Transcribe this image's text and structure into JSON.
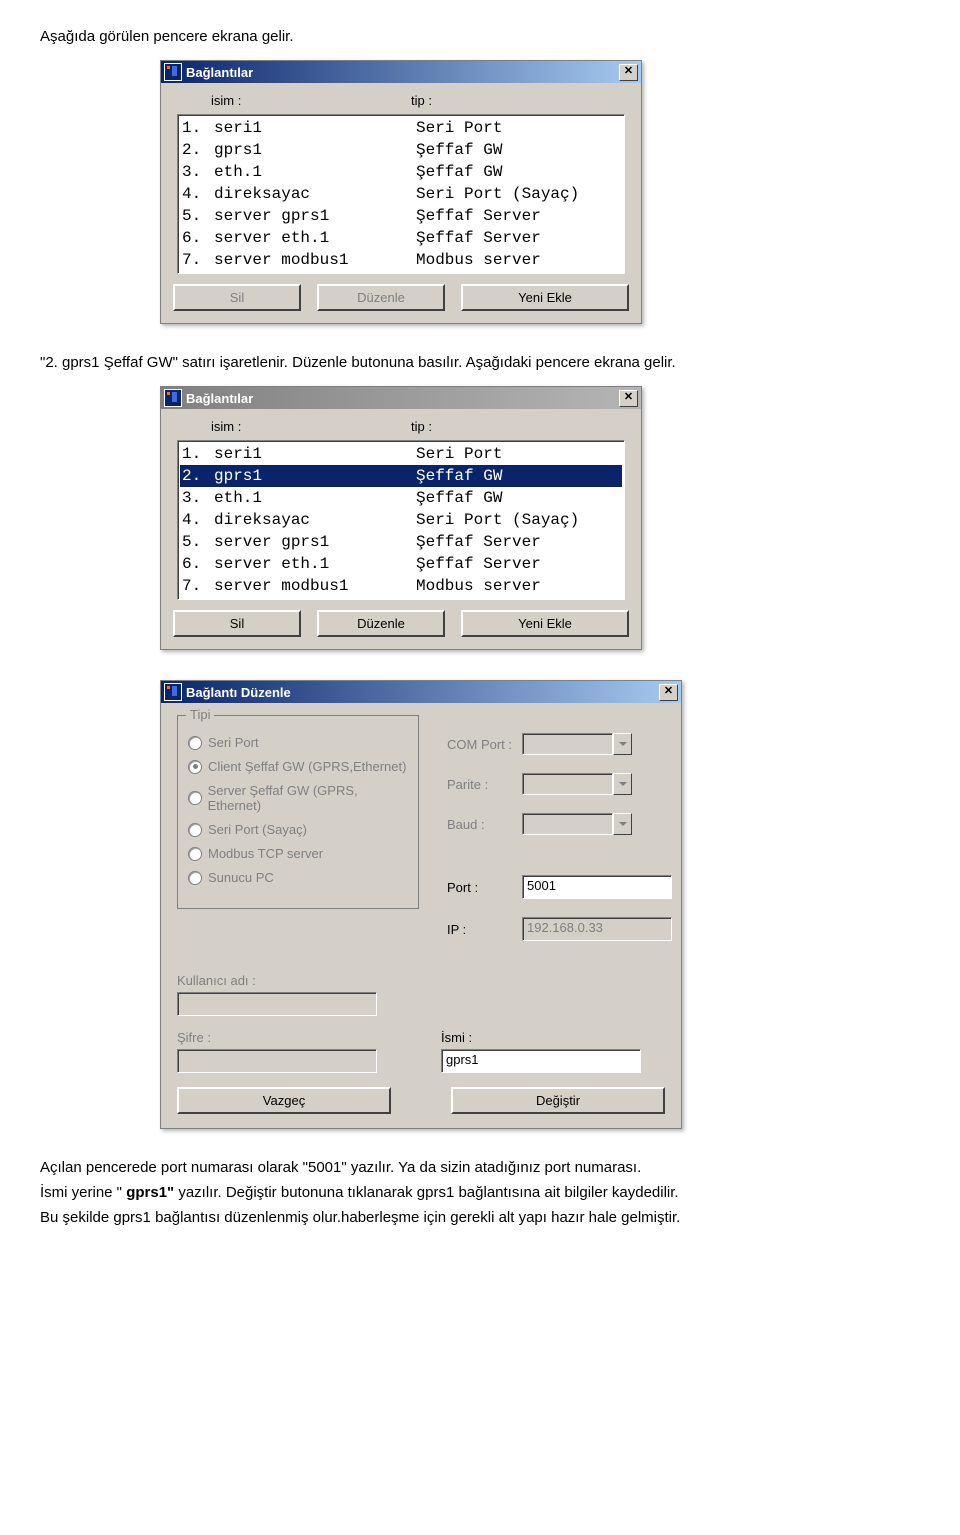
{
  "doc": {
    "line1": "Aşağıda görülen pencere ekrana gelir.",
    "line2_pre": "\"2. gprs1        Şeffaf GW\" satırı işaretlenir. Düzenle butonuna basılır. Aşağıdaki pencere ekrana gelir.",
    "para3_a": "Açılan pencerede port numarası olarak \"5001\" yazılır. Ya da sizin atadığınız port numarası.",
    "para3_b_pre": "İsmi yerine \" ",
    "para3_b_bold": "gprs1\"",
    "para3_b_post": " yazılır. Değiştir butonuna tıklanarak gprs1 bağlantısına ait bilgiler kaydedilir.",
    "para3_c": "Bu şekilde gprs1 bağlantısı düzenlenmiş olur.haberleşme için gerekli alt yapı hazır hale gelmiştir."
  },
  "dlg1": {
    "title": "Bağlantılar",
    "headers": {
      "isim": "isim :",
      "tip": "tip :"
    },
    "rows": [
      {
        "n": "1.",
        "isim": "seri1",
        "tip": "Seri Port"
      },
      {
        "n": "2.",
        "isim": "gprs1",
        "tip": "Şeffaf GW"
      },
      {
        "n": "3.",
        "isim": "eth.1",
        "tip": "Şeffaf GW"
      },
      {
        "n": "4.",
        "isim": "direksayac",
        "tip": "Seri Port (Sayaç)"
      },
      {
        "n": "5.",
        "isim": "server gprs1",
        "tip": "Şeffaf Server"
      },
      {
        "n": "6.",
        "isim": "server eth.1",
        "tip": "Şeffaf Server"
      },
      {
        "n": "7.",
        "isim": "server modbus1",
        "tip": "Modbus server"
      }
    ],
    "buttons": {
      "sil": "Sil",
      "duzenle": "Düzenle",
      "yeni": "Yeni Ekle"
    }
  },
  "dlg2": {
    "title": "Bağlantılar",
    "headers": {
      "isim": "isim :",
      "tip": "tip :"
    },
    "selectedIndex": 1,
    "rows": [
      {
        "n": "1.",
        "isim": "seri1",
        "tip": "Seri Port"
      },
      {
        "n": "2.",
        "isim": "gprs1",
        "tip": "Şeffaf GW"
      },
      {
        "n": "3.",
        "isim": "eth.1",
        "tip": "Şeffaf GW"
      },
      {
        "n": "4.",
        "isim": "direksayac",
        "tip": "Seri Port (Sayaç)"
      },
      {
        "n": "5.",
        "isim": "server gprs1",
        "tip": "Şeffaf Server"
      },
      {
        "n": "6.",
        "isim": "server eth.1",
        "tip": "Şeffaf Server"
      },
      {
        "n": "7.",
        "isim": "server modbus1",
        "tip": "Modbus server"
      }
    ],
    "buttons": {
      "sil": "Sil",
      "duzenle": "Düzenle",
      "yeni": "Yeni Ekle"
    }
  },
  "dlg3": {
    "title": "Bağlantı Düzenle",
    "groupLabel": "Tipi",
    "radios": [
      "Seri Port",
      "Client Şeffaf GW (GPRS,Ethernet)",
      "Server Şeffaf GW (GPRS, Ethernet)",
      "Seri Port (Sayaç)",
      "Modbus TCP server",
      "Sunucu PC"
    ],
    "selectedRadio": 1,
    "right": {
      "comport": "COM Port :",
      "parite": "Parite :",
      "baud": "Baud :",
      "port": "Port :",
      "ip": "IP :"
    },
    "portValue": "5001",
    "ipValue": "192.168.0.33",
    "lower": {
      "kullanici": "Kullanıcı adı :",
      "sifre": "Şifre :",
      "ismi": "İsmi :"
    },
    "ismiValue": "gprs1",
    "buttons": {
      "vazgec": "Vazgeç",
      "degistir": "Değiştir"
    }
  }
}
